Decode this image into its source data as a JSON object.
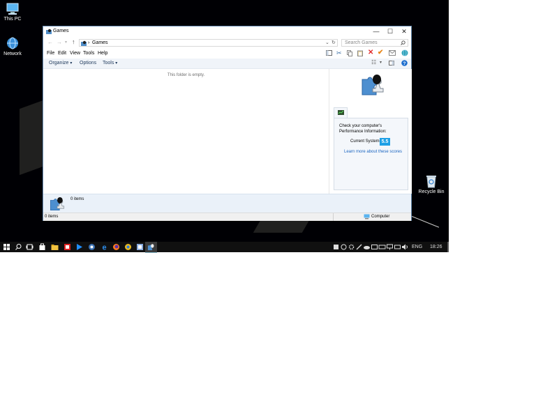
{
  "desktop": {
    "icons": [
      {
        "label": "This PC"
      },
      {
        "label": "Network"
      },
      {
        "label": "Recycle Bin"
      }
    ]
  },
  "window": {
    "title": "Games",
    "controls": {
      "minimize": "—",
      "maximize": "☐",
      "close": "✕"
    },
    "address": {
      "separator": "›",
      "path": "Games"
    },
    "search": {
      "placeholder": "Search Games"
    },
    "menu": {
      "file": "File",
      "edit": "Edit",
      "view": "View",
      "tools": "Tools",
      "help": "Help"
    },
    "commands": {
      "organize": "Organize",
      "options": "Options",
      "tools": "Tools"
    },
    "content": {
      "empty_text": "This folder is empty."
    },
    "perf": {
      "heading": "Check your computer's Performance Information:",
      "current_label": "Current System",
      "score": "5.5",
      "link": "Learn more about these scores"
    },
    "details": {
      "count": "0 items"
    },
    "status": {
      "count": "0 items",
      "location": "Computer"
    }
  },
  "taskbar": {
    "language": "ENG",
    "time": "18:26"
  },
  "colors": {
    "accent": "#0078d7",
    "score_bg": "#1ea0e6",
    "close_red": "#e02b2b",
    "check_orange": "#e8861a"
  }
}
